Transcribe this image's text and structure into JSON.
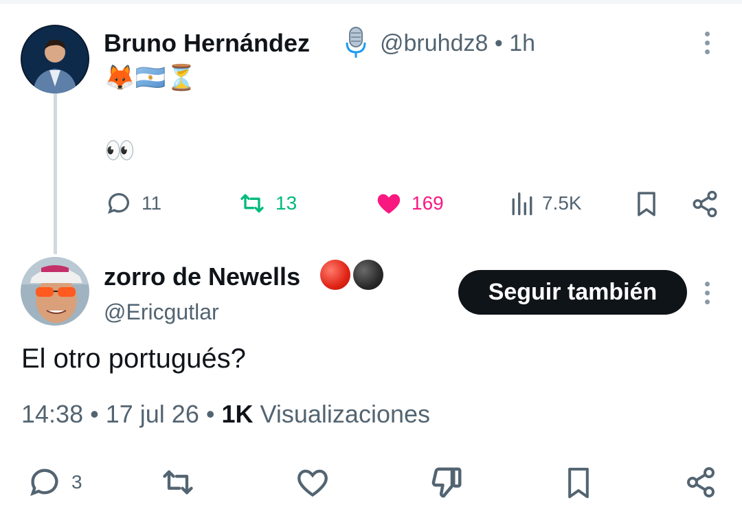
{
  "parent_tweet": {
    "author_name": "Bruno Hernández",
    "badge_icon": "microphone-icon",
    "handle": "@bruhdz8",
    "separator": "•",
    "time_ago": "1h",
    "line1_emojis": "🦊🇦🇷⏳",
    "line2_emojis": "👀",
    "stats": {
      "replies": "11",
      "retweets": "13",
      "likes": "169",
      "views": "7.5K"
    },
    "colors": {
      "retweet": "#00ba7c",
      "like": "#f91880",
      "muted": "#536471"
    }
  },
  "reply_tweet": {
    "author_name": "zorro de Newells",
    "badges": [
      "red-circle-icon",
      "black-circle-icon"
    ],
    "handle": "@Ericgutlar",
    "follow_label": "Seguir también",
    "text": "El otro portugués?",
    "time": "14:38",
    "sep1": "•",
    "date": "17 jul 26",
    "sep2": "•",
    "views_count": "1K",
    "views_label": "Visualizaciones",
    "stats": {
      "replies": "3"
    }
  }
}
